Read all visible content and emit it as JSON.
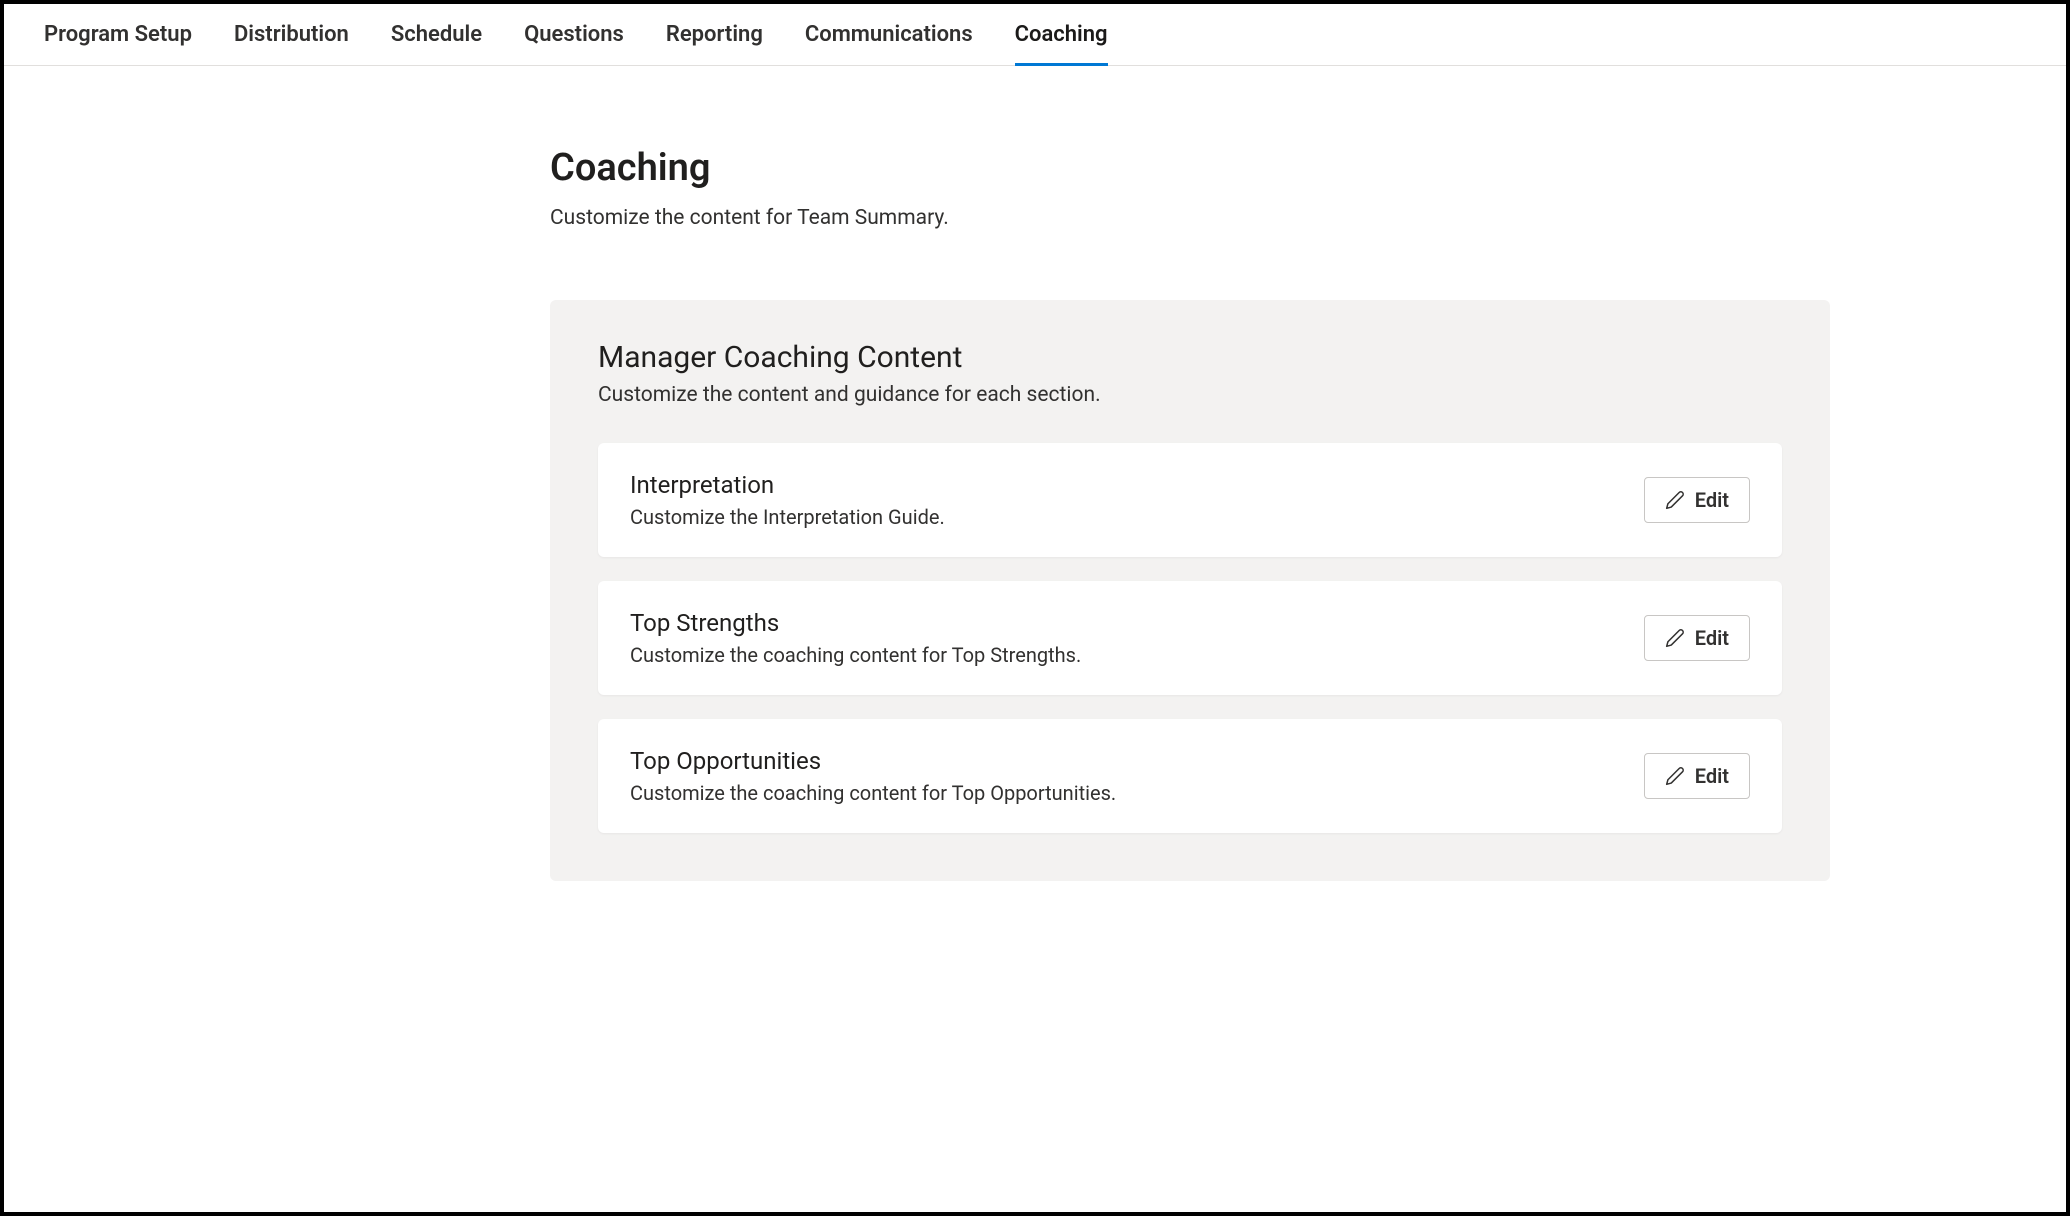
{
  "tabs": [
    {
      "label": "Program Setup"
    },
    {
      "label": "Distribution"
    },
    {
      "label": "Schedule"
    },
    {
      "label": "Questions"
    },
    {
      "label": "Reporting"
    },
    {
      "label": "Communications"
    },
    {
      "label": "Coaching"
    }
  ],
  "page": {
    "title": "Coaching",
    "subtitle": "Customize the content for Team Summary."
  },
  "panel": {
    "title": "Manager Coaching Content",
    "subtitle": "Customize the content and guidance for each section.",
    "edit_label": "Edit",
    "cards": [
      {
        "title": "Interpretation",
        "desc": "Customize the Interpretation Guide."
      },
      {
        "title": "Top Strengths",
        "desc": "Customize the coaching content for Top Strengths."
      },
      {
        "title": "Top Opportunities",
        "desc": "Customize the coaching content for Top Opportunities."
      }
    ]
  }
}
